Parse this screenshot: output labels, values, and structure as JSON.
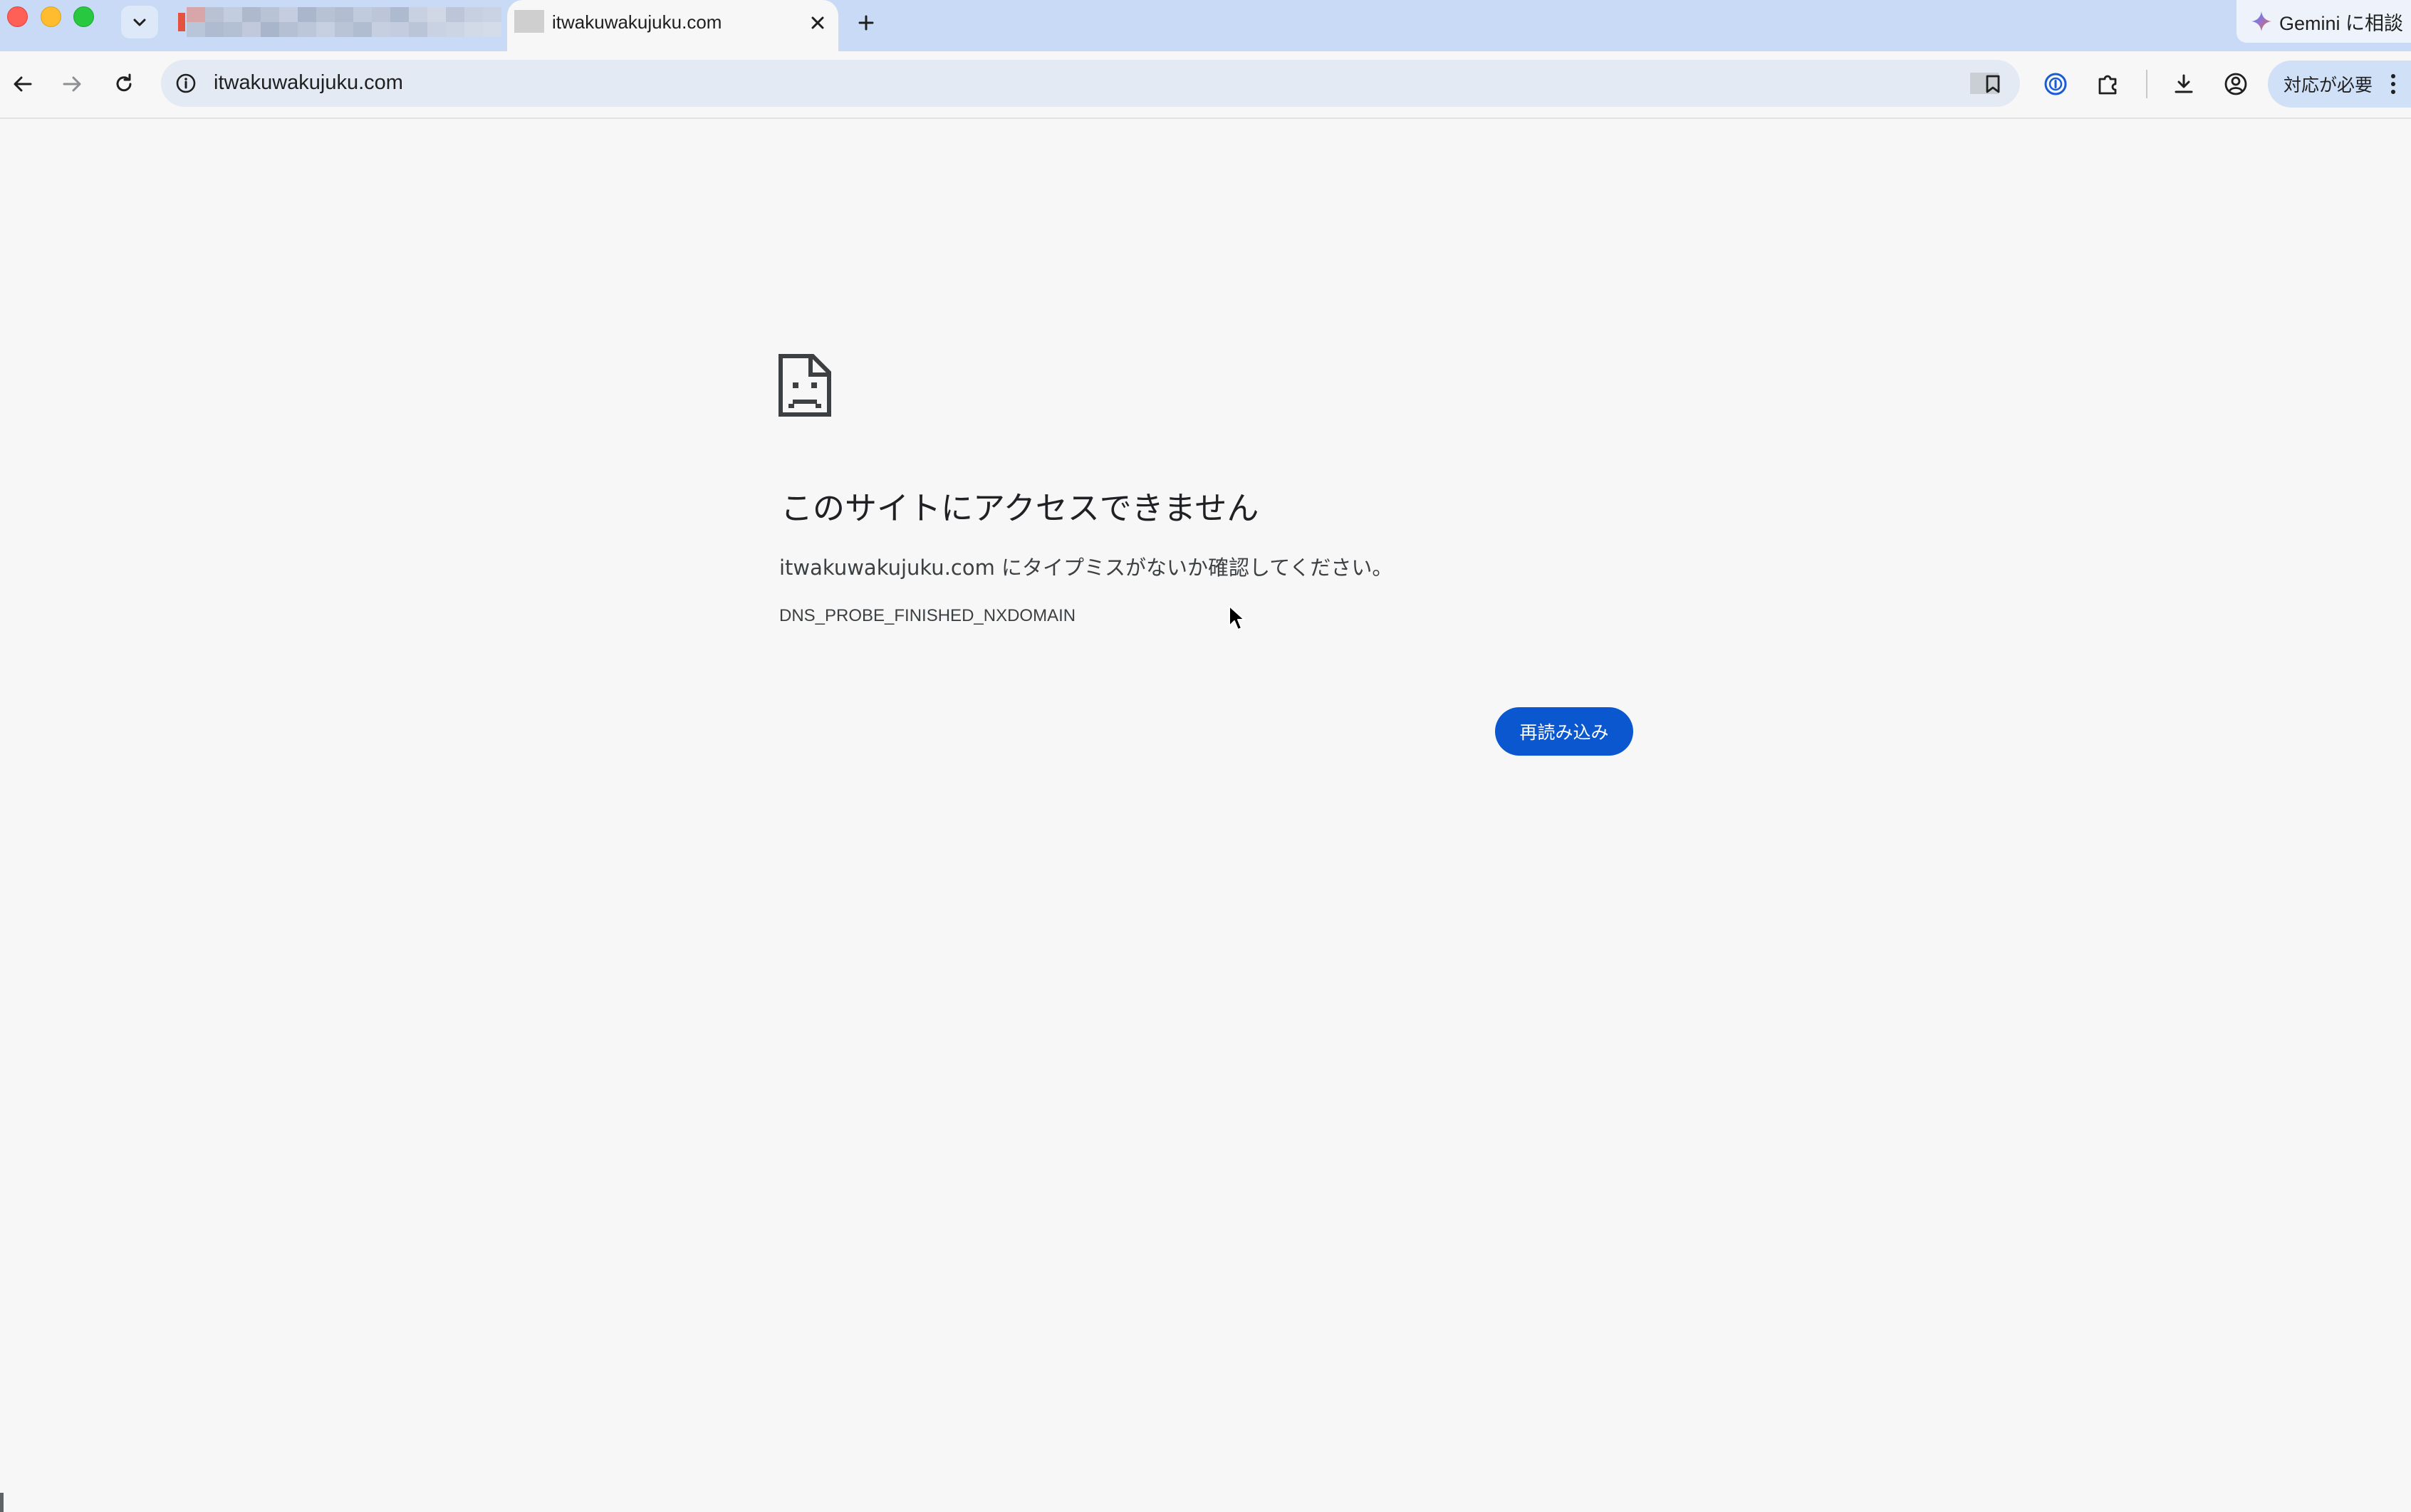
{
  "window": {
    "tabs": [
      {
        "label": "",
        "state": "inactive",
        "blurred": true
      },
      {
        "label": "itwakuwakujuku.com",
        "state": "active"
      }
    ],
    "gemini": {
      "label": "Gemini に相談"
    }
  },
  "toolbar": {
    "url": "itwakuwakujuku.com",
    "update_label": "対応が必要"
  },
  "error_page": {
    "title": "このサイトにアクセスできません",
    "message": "itwakuwakujuku.com にタイプミスがないか確認してください。",
    "error_code": "DNS_PROBE_FINISHED_NXDOMAIN",
    "reload_label": "再読み込み"
  },
  "icons": {
    "back": "arrow-left-icon",
    "forward": "arrow-right-icon",
    "reload": "reload-icon",
    "site_info": "info-icon",
    "bookmark": "bookmark-icon",
    "password_manager": "password-manager-icon",
    "extensions": "puzzle-icon",
    "downloads": "download-icon",
    "profile": "profile-icon",
    "menu": "kebab-menu-icon",
    "error": "sad-document-icon"
  },
  "colors": {
    "tabstrip": "#c8daf5",
    "page_bg": "#f7f7f7",
    "accent": "#0b57d0"
  }
}
